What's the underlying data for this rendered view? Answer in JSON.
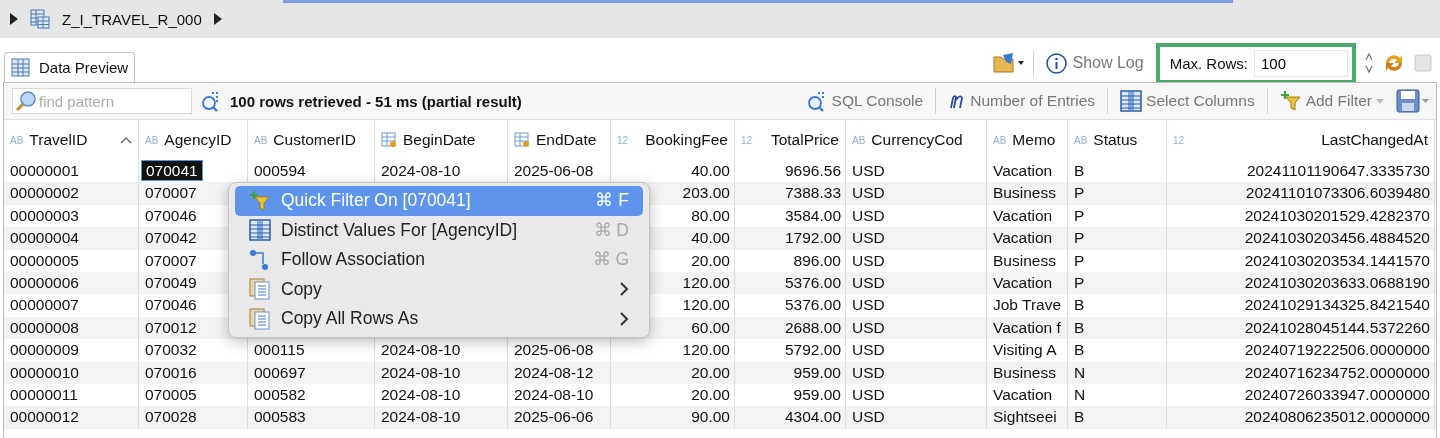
{
  "breadcrumb": {
    "title": "Z_I_TRAVEL_R_000"
  },
  "tabs": [
    {
      "label": "Data Preview",
      "selected": true
    }
  ],
  "top_toolbar": {
    "show_log": "Show Log",
    "max_rows_label": "Max. Rows:",
    "max_rows_value": "100",
    "max_rows_highlighted": true
  },
  "toolbar": {
    "search_placeholder": "find pattern",
    "status": "100 rows retrieved - 51 ms (partial result)",
    "buttons": [
      {
        "kind": "sql",
        "label": "SQL Console"
      },
      {
        "kind": "count",
        "label": "Number of Entries"
      },
      {
        "kind": "columns",
        "label": "Select Columns"
      },
      {
        "kind": "filter",
        "label": "Add Filter"
      }
    ]
  },
  "table": {
    "columns": [
      {
        "label": "TravelID",
        "kind": "text",
        "badge": "AB",
        "sorted_ascending": true
      },
      {
        "label": "AgencyID",
        "kind": "text",
        "badge": "AB",
        "sorted_ascending": false
      },
      {
        "label": "CustomerID",
        "kind": "text",
        "badge": "AB",
        "sorted_ascending": false
      },
      {
        "label": "BeginDate",
        "kind": "date",
        "sorted_ascending": false
      },
      {
        "label": "EndDate",
        "kind": "date",
        "sorted_ascending": false
      },
      {
        "label": "BookingFee",
        "kind": "number",
        "badge": "12",
        "sorted_ascending": false
      },
      {
        "label": "TotalPrice",
        "kind": "number",
        "badge": "12",
        "sorted_ascending": false
      },
      {
        "label": "CurrencyCod",
        "kind": "text",
        "badge": "AB",
        "sorted_ascending": false
      },
      {
        "label": "Memo",
        "kind": "text",
        "badge": "AB",
        "sorted_ascending": false
      },
      {
        "label": "Status",
        "kind": "text",
        "badge": "AB",
        "sorted_ascending": false
      },
      {
        "label": "LastChangedAt",
        "kind": "number",
        "badge": "12",
        "sorted_ascending": false
      }
    ],
    "rows": [
      {
        "selected_cells": [
          false,
          true,
          false,
          false,
          false,
          false,
          false,
          false,
          false,
          false,
          false
        ],
        "cells": [
          "00000001",
          "070041",
          "000594",
          "2024-08-10",
          "2025-06-08",
          "40.00",
          "9696.56",
          "USD",
          "Vacation",
          "B",
          "20241101190647.3335730"
        ]
      },
      {
        "selected_cells": [
          false,
          false,
          null,
          null,
          null,
          false,
          false,
          false,
          false,
          false,
          false
        ],
        "cells": [
          "00000002",
          "070007",
          null,
          null,
          null,
          "203.00",
          "7388.33",
          "USD",
          "Business",
          "P",
          "20241101073306.6039480"
        ]
      },
      {
        "selected_cells": [
          false,
          false,
          null,
          null,
          null,
          false,
          false,
          false,
          false,
          false,
          false
        ],
        "cells": [
          "00000003",
          "070046",
          null,
          null,
          null,
          "80.00",
          "3584.00",
          "USD",
          "Vacation",
          "P",
          "20241030201529.4282370"
        ]
      },
      {
        "selected_cells": [
          false,
          false,
          null,
          null,
          null,
          false,
          false,
          false,
          false,
          false,
          false
        ],
        "cells": [
          "00000004",
          "070042",
          null,
          null,
          null,
          "40.00",
          "1792.00",
          "USD",
          "Vacation",
          "P",
          "20241030203456.4884520"
        ]
      },
      {
        "selected_cells": [
          false,
          false,
          null,
          null,
          null,
          false,
          false,
          false,
          false,
          false,
          false
        ],
        "cells": [
          "00000005",
          "070007",
          null,
          null,
          null,
          "20.00",
          "896.00",
          "USD",
          "Business",
          "P",
          "20241030203534.1441570"
        ]
      },
      {
        "selected_cells": [
          false,
          false,
          null,
          null,
          null,
          false,
          false,
          false,
          false,
          false,
          false
        ],
        "cells": [
          "00000006",
          "070049",
          null,
          null,
          null,
          "120.00",
          "5376.00",
          "USD",
          "Vacation",
          "P",
          "20241030203633.0688190"
        ]
      },
      {
        "selected_cells": [
          false,
          false,
          null,
          null,
          null,
          false,
          false,
          false,
          false,
          false,
          false
        ],
        "cells": [
          "00000007",
          "070046",
          null,
          null,
          null,
          "120.00",
          "5376.00",
          "USD",
          "Job Trave",
          "B",
          "20241029134325.8421540"
        ]
      },
      {
        "selected_cells": [
          false,
          false,
          null,
          null,
          null,
          false,
          false,
          false,
          false,
          false,
          false
        ],
        "cells": [
          "00000008",
          "070012",
          null,
          null,
          null,
          "60.00",
          "2688.00",
          "USD",
          "Vacation f",
          "B",
          "20241028045144.5372260"
        ]
      },
      {
        "selected_cells": [
          false,
          false,
          false,
          false,
          false,
          false,
          false,
          false,
          false,
          false,
          false
        ],
        "cells": [
          "00000009",
          "070032",
          "000115",
          "2024-08-10",
          "2025-06-08",
          "120.00",
          "5792.00",
          "USD",
          "Visiting A",
          "B",
          "20240719222506.0000000"
        ]
      },
      {
        "selected_cells": [
          false,
          false,
          false,
          false,
          false,
          false,
          false,
          false,
          false,
          false,
          false
        ],
        "cells": [
          "00000010",
          "070016",
          "000697",
          "2024-08-10",
          "2024-08-12",
          "20.00",
          "959.00",
          "USD",
          "Business",
          "N",
          "20240716234752.0000000"
        ]
      },
      {
        "selected_cells": [
          false,
          false,
          false,
          false,
          false,
          false,
          false,
          false,
          false,
          false,
          false
        ],
        "cells": [
          "00000011",
          "070005",
          "000582",
          "2024-08-10",
          "2024-08-10",
          "20.00",
          "959.00",
          "USD",
          "Vacation",
          "N",
          "20240726033947.0000000"
        ]
      },
      {
        "selected_cells": [
          false,
          false,
          false,
          false,
          false,
          false,
          false,
          false,
          false,
          false,
          false
        ],
        "cells": [
          "00000012",
          "070028",
          "000583",
          "2024-08-10",
          "2025-06-06",
          "90.00",
          "4304.00",
          "USD",
          "Sightseei",
          "B",
          "20240806235012.0000000"
        ]
      }
    ]
  },
  "context_menu": {
    "items": [
      {
        "kind": "filter",
        "label": "Quick Filter On [070041]",
        "shortcut": "⌘ F",
        "selected": true,
        "submenu": false
      },
      {
        "kind": "distinct",
        "label": "Distinct Values For [AgencyID]",
        "shortcut": "⌘ D",
        "selected": false,
        "submenu": false
      },
      {
        "kind": "association",
        "label": "Follow Association",
        "shortcut": "⌘ G",
        "selected": false,
        "submenu": false
      },
      {
        "kind": "copy",
        "label": "Copy",
        "selected": false,
        "submenu": true
      },
      {
        "kind": "copy",
        "label": "Copy All Rows As",
        "selected": false,
        "submenu": true
      }
    ]
  }
}
